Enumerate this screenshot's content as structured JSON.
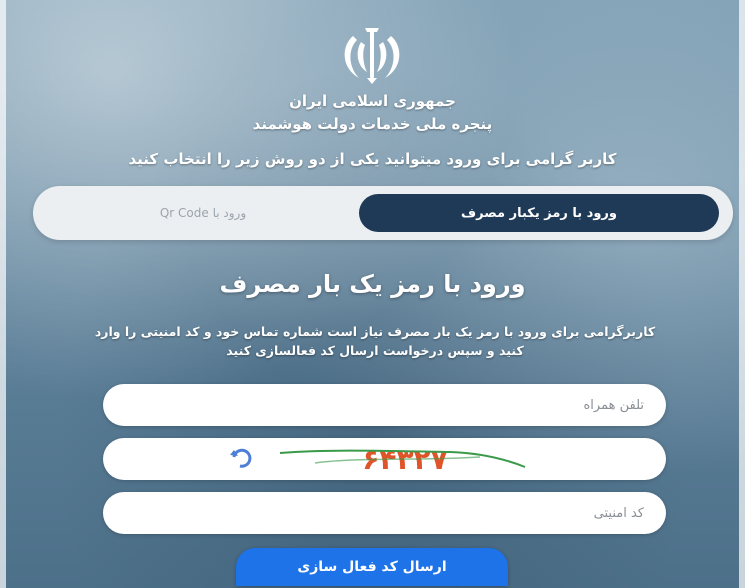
{
  "header": {
    "country": "جمهوری اسلامی ایران",
    "portal_title": "پنجره ملی خدمات دولت هوشمند",
    "instruction": "کاربر گرامی برای ورود میتوانید یکی از دو روش زیر را انتخاب کنید"
  },
  "login_tabs": {
    "active_label": "ورود با رمز یکبار مصرف",
    "inactive_label": "ورود با Qr Code"
  },
  "section": {
    "title": "ورود با رمز یک بار مصرف",
    "description_line1": "کاربرگرامی برای ورود با رمز یک بار مصرف نیاز است شماره تماس خود و کد امنیتی را وارد",
    "description_line2": "کنید و سپس درخواست ارسال کد فعالسازی کنید"
  },
  "form": {
    "phone_placeholder": "تلفن همراه",
    "captcha_code": "۶۴۳۲۷",
    "security_code_placeholder": "کد امنیتی",
    "submit_label": "ارسال کد فعال سازی"
  },
  "colors": {
    "active_tab": "#1f3a57",
    "submit_button": "#1e73e8",
    "tab_bar": "#eceff2"
  },
  "icons": {
    "emblem": "iran-emblem-icon",
    "refresh": "refresh-captcha-icon"
  }
}
